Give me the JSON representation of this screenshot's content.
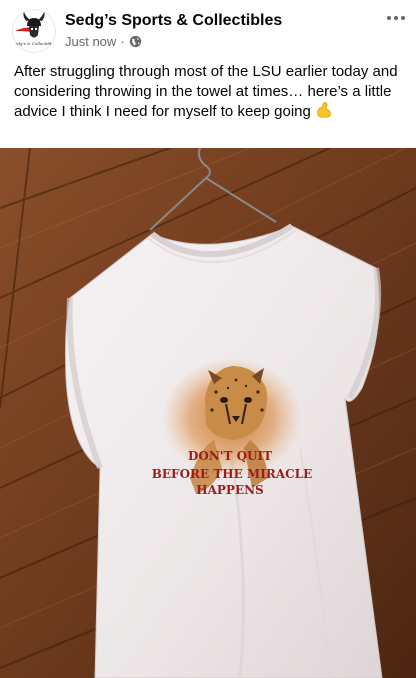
{
  "post": {
    "page_name": "Sedg’s Sports & Collectibles",
    "timestamp": "Just now",
    "separator": "·",
    "audience_icon": "globe-icon",
    "menu_icon": "more-horizontal-icon",
    "text": "After struggling through most of the LSU earlier today and considering throwing in the towel at times… here’s a little advice I think I need for myself to keep going",
    "emoji": "flexed-biceps",
    "avatar": {
      "logo_text": "Sedg's & Collectibles",
      "icon": "viking-helmet-logo"
    }
  },
  "photo": {
    "subject": "sleeveless-white-tee-on-hanger",
    "shirt_print": {
      "line1": "DON'T QUIT",
      "line2": "BEFORE THE MIRACLE",
      "line3": "HAPPENS",
      "graphic": "cheetah"
    }
  },
  "colors": {
    "text_primary": "#050505",
    "text_secondary": "#65676b",
    "wood": "#6b3a1f",
    "shirt": "#f2eeef",
    "print_red": "#9b1c1c"
  }
}
